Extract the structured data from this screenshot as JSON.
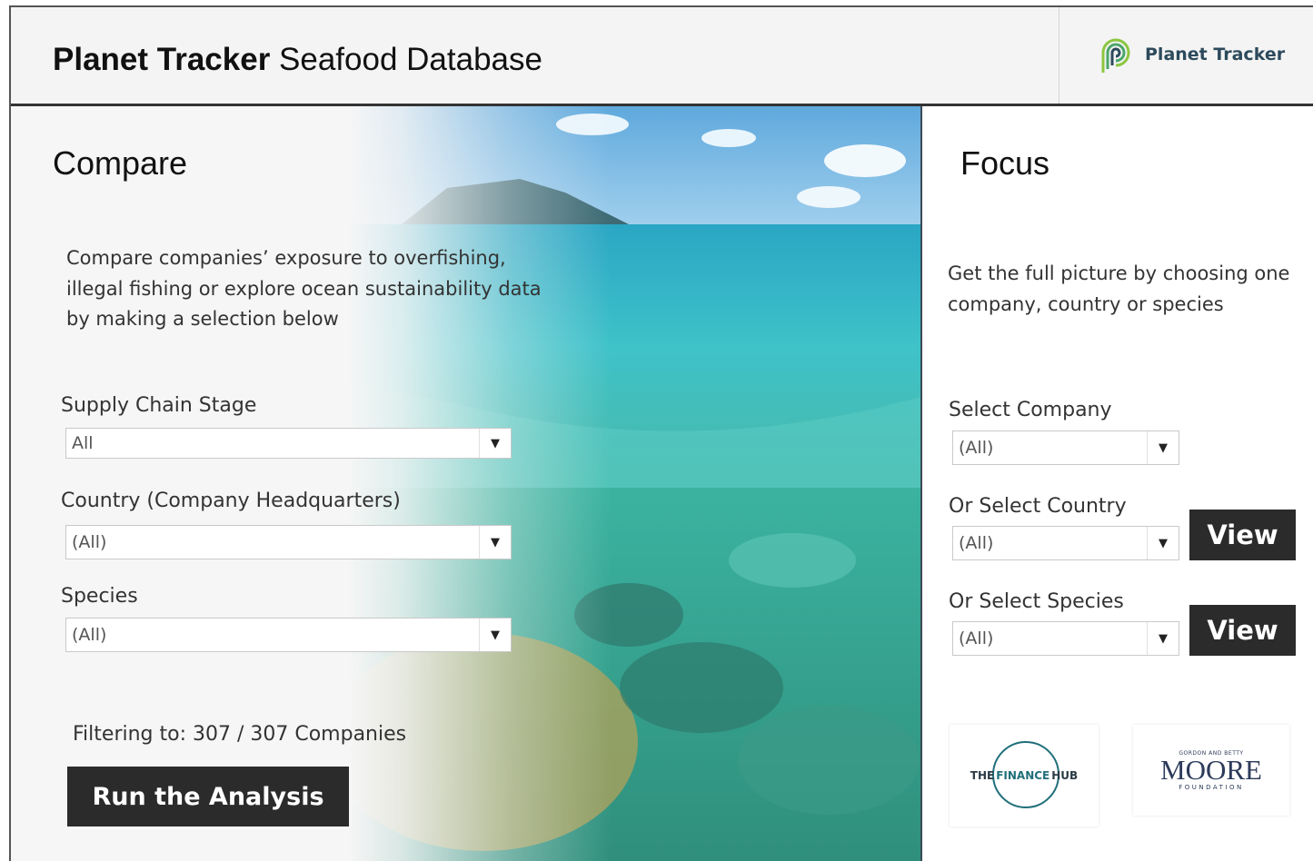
{
  "header": {
    "title_bold": "Planet Tracker",
    "title_rest": " Seafood Database",
    "brand": "Planet Tracker"
  },
  "compare": {
    "title": "Compare",
    "description": "Compare companies’ exposure to overfishing, illegal fishing or explore ocean sustainability data by making a selection below",
    "supply_chain_label": "Supply Chain Stage",
    "supply_chain_value": "All",
    "country_label": "Country (Company Headquarters)",
    "country_value": "(All)",
    "species_label": "Species",
    "species_value": "(All)",
    "filter_text": "Filtering to: 307 / 307 Companies",
    "run_button": "Run the Analysis"
  },
  "focus": {
    "title": "Focus",
    "description": "Get the full picture by choosing one company, country or species",
    "company_label": "Select Company",
    "company_value": "(All)",
    "country_label": "Or Select Country",
    "country_value": "(All)",
    "country_button": "View",
    "species_label": "Or Select Species",
    "species_value": "(All)",
    "species_button": "View"
  },
  "logos": {
    "finance_hub": {
      "left": "THE",
      "middle": "FINANCE",
      "right": "HUB"
    },
    "moore": {
      "top": "GORDON AND BETTY",
      "name": "MOORE",
      "bottom": "FOUNDATION"
    }
  },
  "colors": {
    "dark_button": "#2b2b2b",
    "brand_green": "#8cc63f",
    "brand_navy": "#2d4a5c",
    "finance_teal": "#1f6f7a"
  },
  "icons": {
    "dropdown": "caret-down-icon",
    "brand": "planet-tracker-logo-icon"
  }
}
